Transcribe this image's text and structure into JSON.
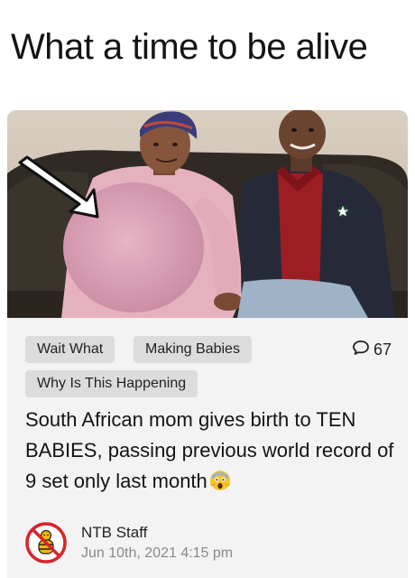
{
  "page": {
    "title": "What a time to be alive"
  },
  "post": {
    "image": {
      "alt_subject": "photo-couple-on-couch",
      "overlay_icon": "white-arrow-icon"
    },
    "tags": [
      {
        "label": "Wait What"
      },
      {
        "label": "Making Babies"
      },
      {
        "label": "Why Is This Happening"
      }
    ],
    "comments": {
      "icon": "speech-bubble-icon",
      "count": "67"
    },
    "headline": "South African mom gives birth to TEN BABIES, passing previous world record of 9 set only last month",
    "headline_emoji": "screaming-face-emoji",
    "author": {
      "avatar_icon": "ntb-no-babies-logo-icon",
      "name": "NTB Staff",
      "date": "Jun 10th, 2021 4:15 pm"
    }
  },
  "colors": {
    "card_background": "#f3f3f3",
    "tag_background": "#dcdcdc",
    "text": "#141414",
    "muted_text": "#8a8a8a",
    "logo_red": "#d8232a",
    "logo_gold": "#f2b705"
  }
}
